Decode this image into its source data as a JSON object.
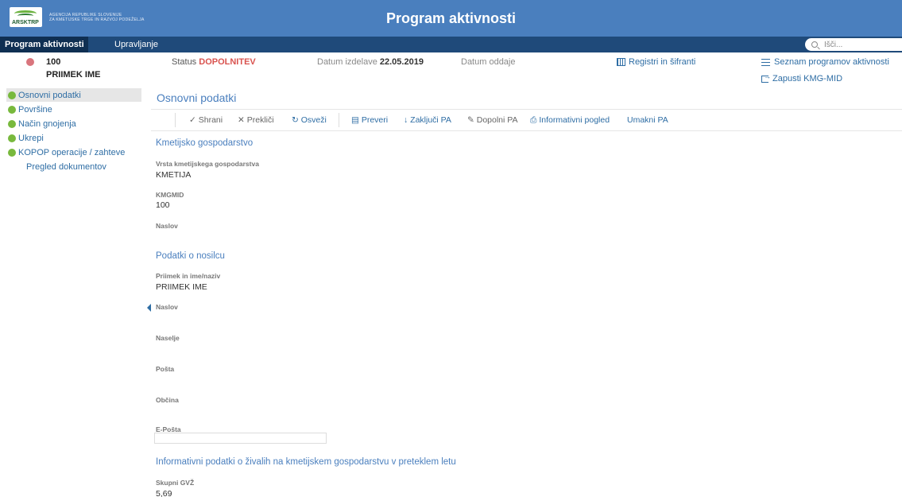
{
  "header": {
    "logo_abbr": "ARSKTRP",
    "logo_line1": "AGENCIJA REPUBLIKE SLOVENIJE",
    "logo_line2": "ZA KMETIJSKE TRGE IN RAZVOJ PODEŽELJA",
    "title": "Program aktivnosti"
  },
  "nav": {
    "tabs": [
      {
        "label": "Program aktivnosti",
        "active": true
      },
      {
        "label": "Upravljanje",
        "active": false
      }
    ],
    "search_placeholder": "Išči..."
  },
  "info_bar": {
    "kmg_mid": "100",
    "holder": "PRIIMEK IME",
    "status_label": "Status",
    "status_value": "DOPOLNITEV",
    "date_created_label": "Datum izdelave",
    "date_created_value": "22.05.2019",
    "date_submitted_label": "Datum oddaje",
    "registers_link": "Registri in šifranti",
    "programs_list_link": "Seznam programov aktivnosti",
    "exit_link": "Zapusti KMG-MID",
    "status_color": "#d9534f"
  },
  "sidebar": {
    "items": [
      {
        "label": "Osnovni podatki",
        "active": true,
        "dot": true
      },
      {
        "label": "Površine",
        "active": false,
        "dot": true
      },
      {
        "label": "Način gnojenja",
        "active": false,
        "dot": true
      },
      {
        "label": "Ukrepi",
        "active": false,
        "dot": true
      },
      {
        "label": "KOPOP operacije / zahteve",
        "active": false,
        "dot": true
      },
      {
        "label": "Pregled dokumentov",
        "active": false,
        "dot": false
      }
    ]
  },
  "main": {
    "title": "Osnovni podatki",
    "toolbar": {
      "save": "Shrani",
      "cancel": "Prekliči",
      "refresh": "Osveži",
      "check": "Preveri",
      "finish": "Zaključi PA",
      "supplement": "Dopolni PA",
      "info_view": "Informativni pogled",
      "withdraw": "Umakni PA"
    },
    "farm_section": {
      "heading": "Kmetijsko gospodarstvo",
      "type_label": "Vrsta kmetijskega gospodarstva",
      "type_value": "KMETIJA",
      "kmgmid_label": "KMGMID",
      "kmgmid_value": "100",
      "address_label": "Naslov"
    },
    "holder_section": {
      "heading": "Podatki o nosilcu",
      "name_label": "Priimek in ime/naziv",
      "name_value": "PRIIMEK IME",
      "address_label": "Naslov",
      "settlement_label": "Naselje",
      "post_label": "Pošta",
      "municipality_label": "Občina",
      "email_label": "E-Pošta",
      "email_value": ""
    },
    "animals_section": {
      "heading": "Informativni podatki o živalih na kmetijskem gospodarstvu v preteklem letu",
      "gvz_label": "Skupni GVŽ",
      "gvz_value": "5,69"
    }
  },
  "colors": {
    "header_bg": "#4a7fbe",
    "nav_bg": "#1f4a7a",
    "nav_active_bg": "#0f2f52",
    "link": "#2e6da4",
    "green_dot": "#78b93d",
    "red_dot": "#d9757d"
  }
}
